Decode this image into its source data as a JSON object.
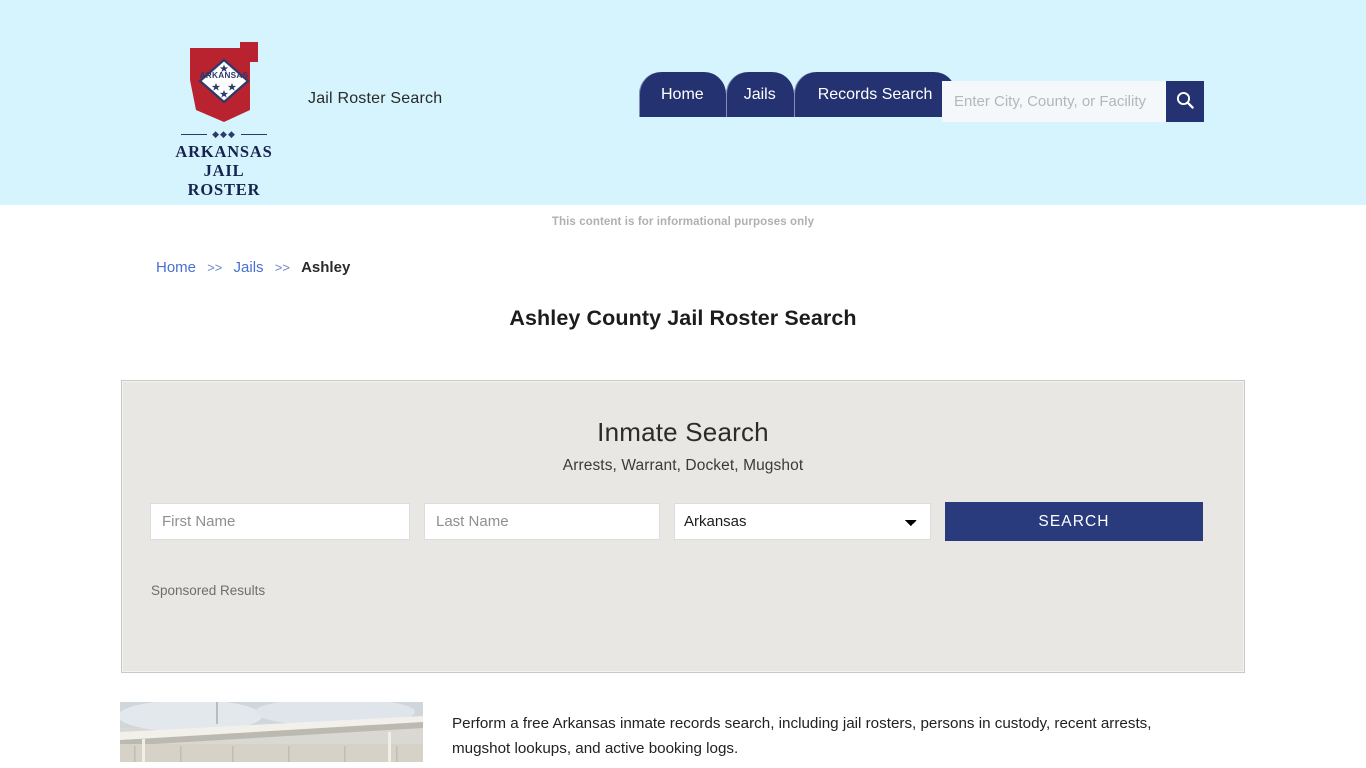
{
  "header": {
    "logo": {
      "icon_name": "arkansas-state-logo",
      "wordmark_line1": "ARKANSAS",
      "wordmark_line2": "JAIL ROSTER",
      "state_label": "ARKANSAS"
    },
    "tagline": "Jail Roster Search",
    "nav": [
      {
        "label": "Home"
      },
      {
        "label": "Jails"
      },
      {
        "label": "Records Search"
      }
    ],
    "search": {
      "value": "",
      "placeholder": "Enter City, County, or Facility",
      "button_icon": "search-icon"
    },
    "bg_color": "#d6f4fd",
    "accent_color": "#253271"
  },
  "disclaimer": "This content is for informational purposes only",
  "breadcrumb": {
    "items": [
      {
        "label": "Home",
        "type": "link"
      },
      {
        "label": "Jails",
        "type": "link"
      },
      {
        "label": "Ashley",
        "type": "current"
      }
    ],
    "separator": ">>"
  },
  "page_title": "Ashley County Jail Roster Search",
  "inmate_search": {
    "title": "Inmate Search",
    "subtitle": "Arrests, Warrant, Docket, Mugshot",
    "first_name": {
      "value": "",
      "placeholder": "First Name"
    },
    "last_name": {
      "value": "",
      "placeholder": "Last Name"
    },
    "state": {
      "selected": "Arkansas",
      "options": [
        "Arkansas"
      ]
    },
    "submit_label": "SEARCH",
    "sponsored_label": "Sponsored Results",
    "panel_bg": "#e8e7e3",
    "button_color": "#2a3b7d"
  },
  "bottom": {
    "photo_alt": "jail-building-photo",
    "paragraph": "Perform a free Arkansas inmate records search, including jail rosters, persons in custody, recent arrests, mugshot lookups, and active booking logs."
  }
}
